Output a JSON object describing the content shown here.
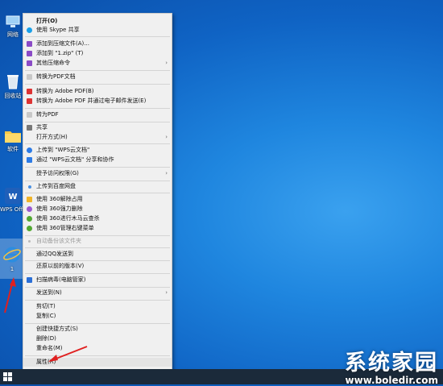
{
  "desktop": {
    "icons": [
      {
        "label": "网络"
      },
      {
        "label": "回收站"
      },
      {
        "label": "软件"
      },
      {
        "label": "WPS Office"
      },
      {
        "label": "1"
      }
    ]
  },
  "menu": {
    "open": "打开(O)",
    "skype": "使用 Skype 共享",
    "add_archive": "添加到压缩文件(A)...",
    "add_zip": "添加到 \"1.zip\" (T)",
    "other_compress": "其他压缩命令",
    "to_pdf_doc": "转换为PDF文档",
    "adobe_pdf": "转换为 Adobe PDF(B)",
    "adobe_pdf_mail": "转换为 Adobe PDF 并通过电子邮件发送(E)",
    "to_pdf": "转为PDF",
    "share": "共享",
    "open_with": "打开方式(H)",
    "upload_wps": "上传到 \"WPS云文档\"",
    "share_wps": "通过 \"WPS云文档\" 分享和协作",
    "grant_access": "授予访问权限(G)",
    "upload_baidu": "上传到百度网盘",
    "unlock_360": "使用 360解除占用",
    "delete_360": "使用 360强力删除",
    "scan_360": "使用 360进行木马云查杀",
    "manage_360": "使用 360管理右键菜单",
    "auto_backup": "自动备份该文件夹",
    "send_qq": "通过QQ发送到",
    "restore": "还原以前的版本(V)",
    "scan_virus": "扫描病毒(电脑管家)",
    "send_to": "发送到(N)",
    "cut": "剪切(T)",
    "copy": "复制(C)",
    "shortcut": "创建快捷方式(S)",
    "delete": "删除(D)",
    "rename": "重命名(M)",
    "properties": "属性(R)"
  },
  "watermark": {
    "title": "系统家园",
    "url": "www.boledir.com"
  },
  "colors": {
    "arrow": "#e02020",
    "menu_bg": "#f0f0f0",
    "desktop": "#1f86df"
  }
}
